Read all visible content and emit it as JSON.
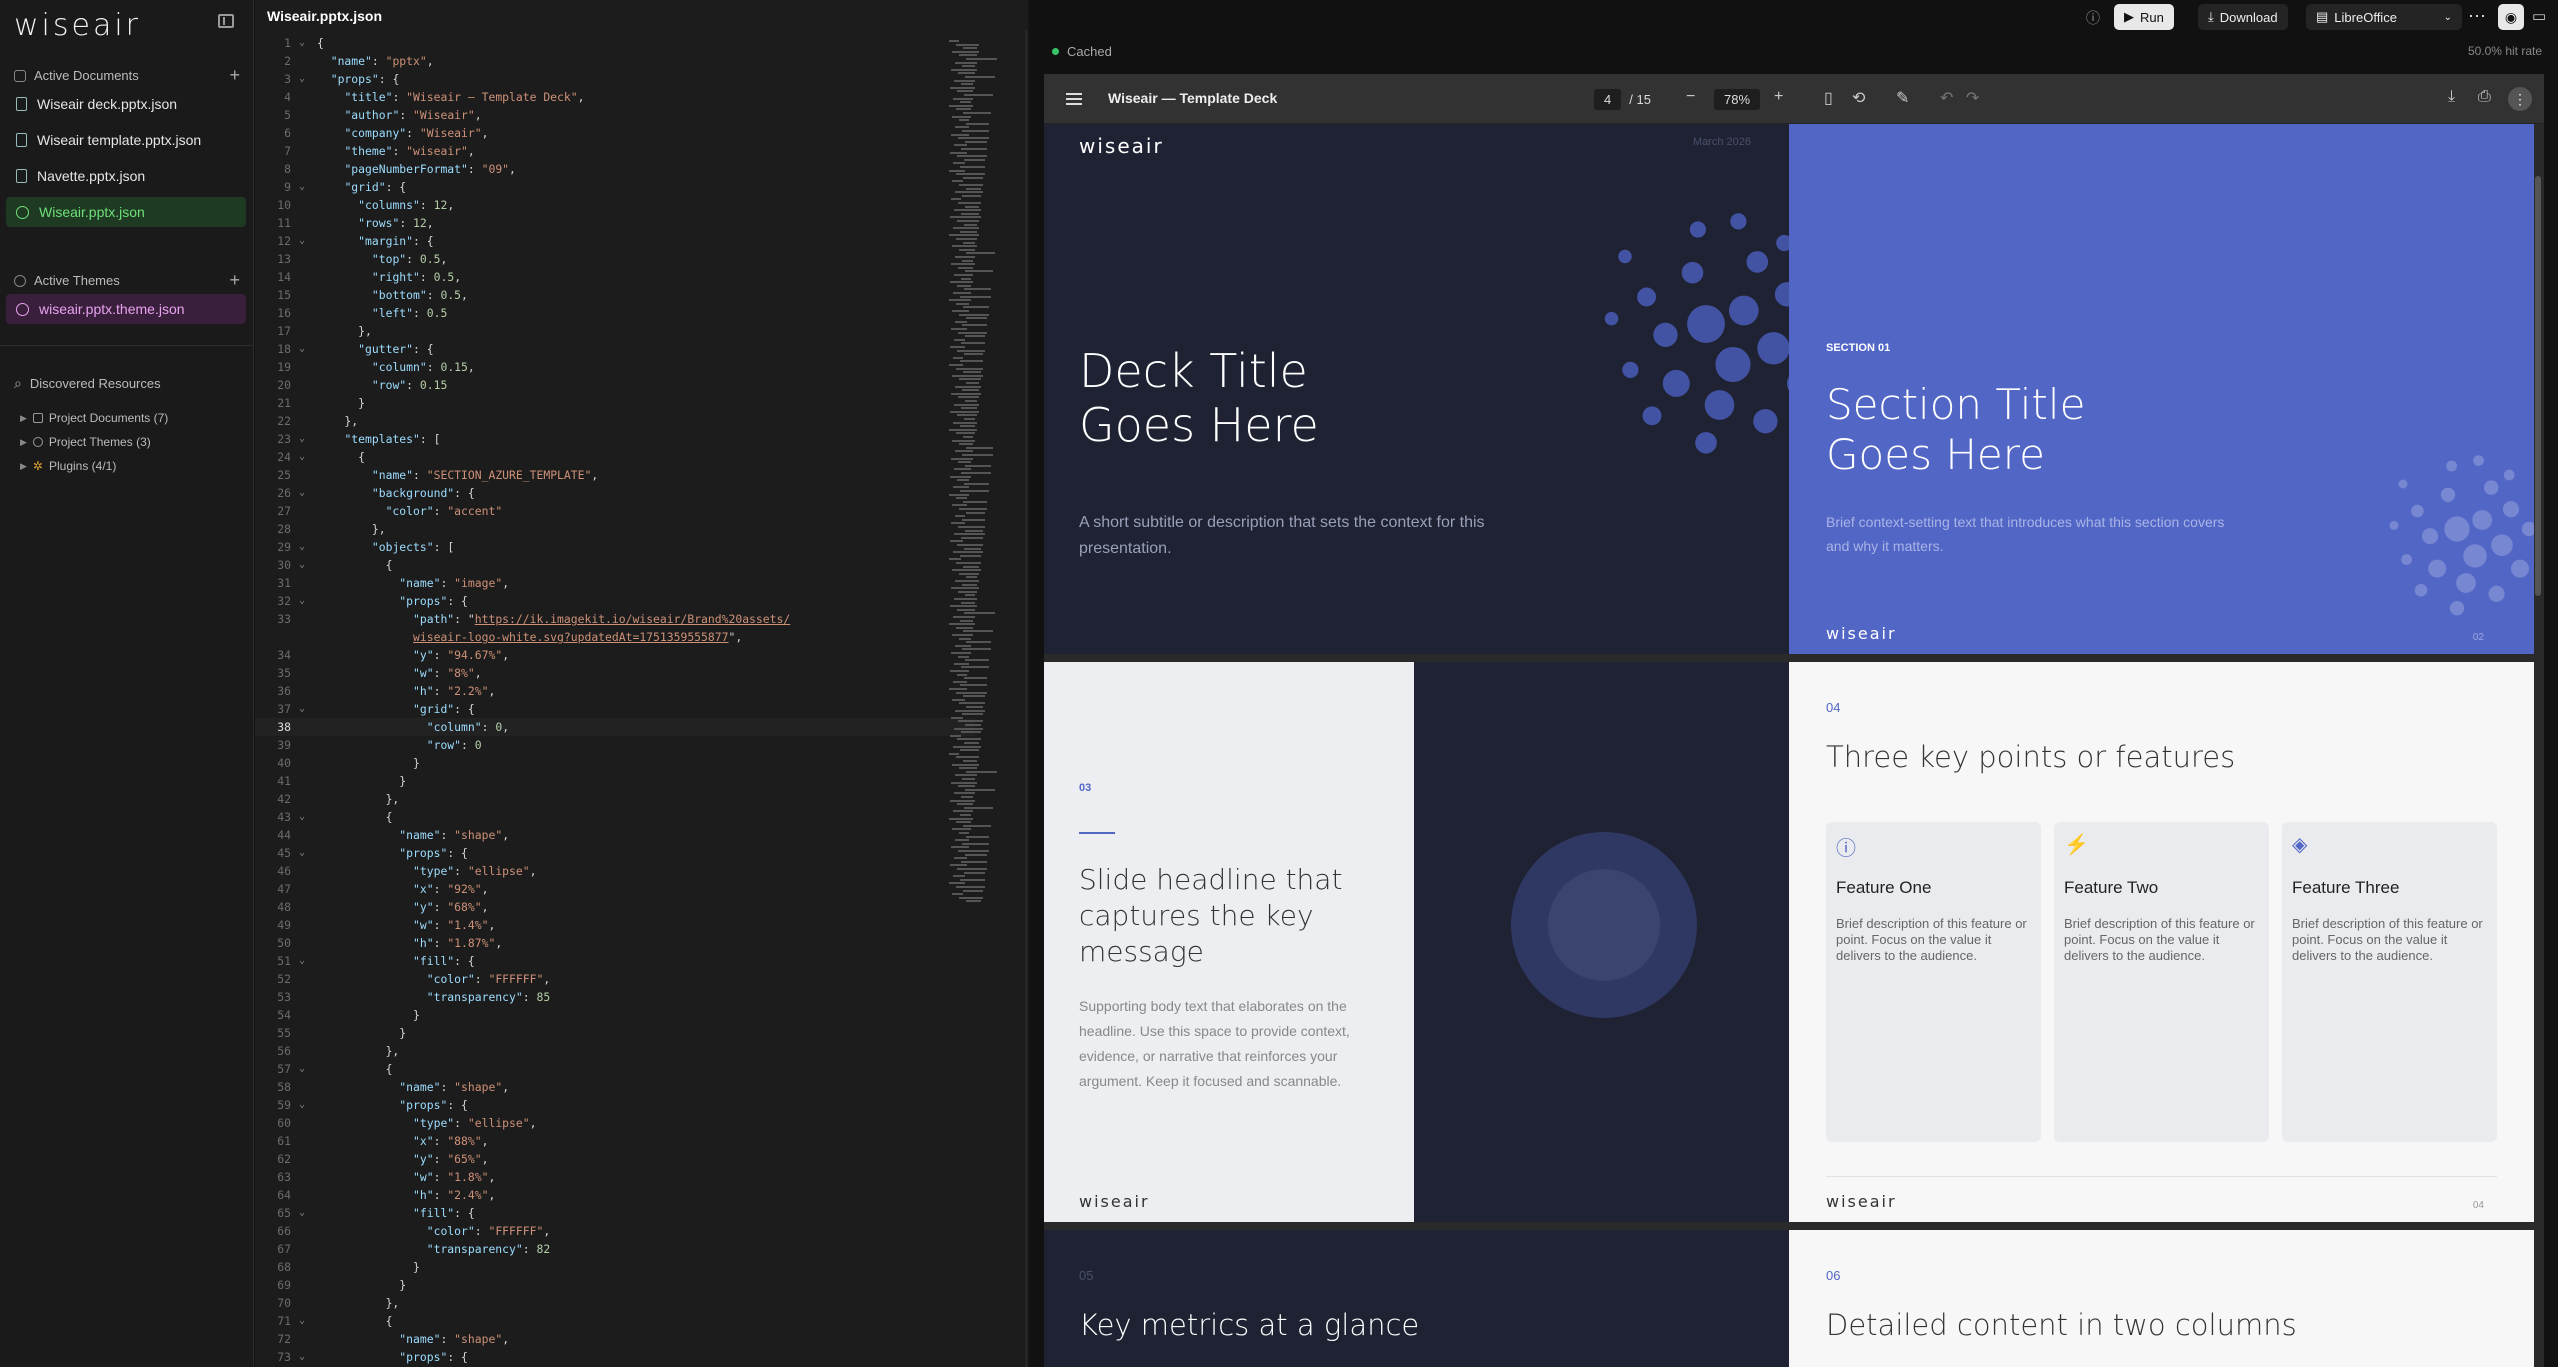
{
  "sidebar": {
    "brand": "wiseair",
    "active_documents_label": "Active Documents",
    "documents": [
      "Wiseair deck.pptx.json",
      "Wiseair template.pptx.json",
      "Navette.pptx.json",
      "Wiseair.pptx.json"
    ],
    "active_themes_label": "Active Themes",
    "themes": [
      "wiseair.pptx.theme.json"
    ],
    "discovered_label": "Discovered Resources",
    "resources": [
      "Project Documents (7)",
      "Project Themes (3)",
      "Plugins (4/1)"
    ]
  },
  "editor": {
    "file_name": "Wiseair.pptx.json",
    "current_line": 38,
    "lines": [
      {
        "n": "1",
        "f": "v",
        "t": "{"
      },
      {
        "n": "2",
        "f": "",
        "t": "  \"name\": \"pptx\","
      },
      {
        "n": "3",
        "f": "v",
        "t": "  \"props\": {"
      },
      {
        "n": "4",
        "f": "",
        "t": "    \"title\": \"Wiseair — Template Deck\","
      },
      {
        "n": "5",
        "f": "",
        "t": "    \"author\": \"Wiseair\","
      },
      {
        "n": "6",
        "f": "",
        "t": "    \"company\": \"Wiseair\","
      },
      {
        "n": "7",
        "f": "",
        "t": "    \"theme\": \"wiseair\","
      },
      {
        "n": "8",
        "f": "",
        "t": "    \"pageNumberFormat\": \"09\","
      },
      {
        "n": "9",
        "f": "v",
        "t": "    \"grid\": {"
      },
      {
        "n": "10",
        "f": "",
        "t": "      \"columns\": 12,"
      },
      {
        "n": "11",
        "f": "",
        "t": "      \"rows\": 12,"
      },
      {
        "n": "12",
        "f": "v",
        "t": "      \"margin\": {"
      },
      {
        "n": "13",
        "f": "",
        "t": "        \"top\": 0.5,"
      },
      {
        "n": "14",
        "f": "",
        "t": "        \"right\": 0.5,"
      },
      {
        "n": "15",
        "f": "",
        "t": "        \"bottom\": 0.5,"
      },
      {
        "n": "16",
        "f": "",
        "t": "        \"left\": 0.5"
      },
      {
        "n": "17",
        "f": "",
        "t": "      },"
      },
      {
        "n": "18",
        "f": "v",
        "t": "      \"gutter\": {"
      },
      {
        "n": "19",
        "f": "",
        "t": "        \"column\": 0.15,"
      },
      {
        "n": "20",
        "f": "",
        "t": "        \"row\": 0.15"
      },
      {
        "n": "21",
        "f": "",
        "t": "      }"
      },
      {
        "n": "22",
        "f": "",
        "t": "    },"
      },
      {
        "n": "23",
        "f": "v",
        "t": "    \"templates\": ["
      },
      {
        "n": "24",
        "f": "v",
        "t": "      {"
      },
      {
        "n": "25",
        "f": "",
        "t": "        \"name\": \"SECTION_AZURE_TEMPLATE\","
      },
      {
        "n": "26",
        "f": "v",
        "t": "        \"background\": {"
      },
      {
        "n": "27",
        "f": "",
        "t": "          \"color\": \"accent\""
      },
      {
        "n": "28",
        "f": "",
        "t": "        },"
      },
      {
        "n": "29",
        "f": "v",
        "t": "        \"objects\": ["
      },
      {
        "n": "30",
        "f": "v",
        "t": "          {"
      },
      {
        "n": "31",
        "f": "",
        "t": "            \"name\": \"image\","
      },
      {
        "n": "32",
        "f": "v",
        "t": "            \"props\": {"
      },
      {
        "n": "33",
        "f": "",
        "t": "              \"path\": \"https://ik.imagekit.io/wiseair/Brand%20assets/"
      },
      {
        "n": "",
        "f": "",
        "t": "              wiseair-logo-white.svg?updatedAt=1751359555877\","
      },
      {
        "n": "34",
        "f": "",
        "t": "              \"y\": \"94.67%\","
      },
      {
        "n": "35",
        "f": "",
        "t": "              \"w\": \"8%\","
      },
      {
        "n": "36",
        "f": "",
        "t": "              \"h\": \"2.2%\","
      },
      {
        "n": "37",
        "f": "v",
        "t": "              \"grid\": {"
      },
      {
        "n": "38",
        "f": "",
        "t": "                \"column\": 0,"
      },
      {
        "n": "39",
        "f": "",
        "t": "                \"row\": 0"
      },
      {
        "n": "40",
        "f": "",
        "t": "              }"
      },
      {
        "n": "41",
        "f": "",
        "t": "            }"
      },
      {
        "n": "42",
        "f": "",
        "t": "          },"
      },
      {
        "n": "43",
        "f": "v",
        "t": "          {"
      },
      {
        "n": "44",
        "f": "",
        "t": "            \"name\": \"shape\","
      },
      {
        "n": "45",
        "f": "v",
        "t": "            \"props\": {"
      },
      {
        "n": "46",
        "f": "",
        "t": "              \"type\": \"ellipse\","
      },
      {
        "n": "47",
        "f": "",
        "t": "              \"x\": \"92%\","
      },
      {
        "n": "48",
        "f": "",
        "t": "              \"y\": \"68%\","
      },
      {
        "n": "49",
        "f": "",
        "t": "              \"w\": \"1.4%\","
      },
      {
        "n": "50",
        "f": "",
        "t": "              \"h\": \"1.87%\","
      },
      {
        "n": "51",
        "f": "v",
        "t": "              \"fill\": {"
      },
      {
        "n": "52",
        "f": "",
        "t": "                \"color\": \"FFFFFF\","
      },
      {
        "n": "53",
        "f": "",
        "t": "                \"transparency\": 85"
      },
      {
        "n": "54",
        "f": "",
        "t": "              }"
      },
      {
        "n": "55",
        "f": "",
        "t": "            }"
      },
      {
        "n": "56",
        "f": "",
        "t": "          },"
      },
      {
        "n": "57",
        "f": "v",
        "t": "          {"
      },
      {
        "n": "58",
        "f": "",
        "t": "            \"name\": \"shape\","
      },
      {
        "n": "59",
        "f": "v",
        "t": "            \"props\": {"
      },
      {
        "n": "60",
        "f": "",
        "t": "              \"type\": \"ellipse\","
      },
      {
        "n": "61",
        "f": "",
        "t": "              \"x\": \"88%\","
      },
      {
        "n": "62",
        "f": "",
        "t": "              \"y\": \"65%\","
      },
      {
        "n": "63",
        "f": "",
        "t": "              \"w\": \"1.8%\","
      },
      {
        "n": "64",
        "f": "",
        "t": "              \"h\": \"2.4%\","
      },
      {
        "n": "65",
        "f": "v",
        "t": "              \"fill\": {"
      },
      {
        "n": "66",
        "f": "",
        "t": "                \"color\": \"FFFFFF\","
      },
      {
        "n": "67",
        "f": "",
        "t": "                \"transparency\": 82"
      },
      {
        "n": "68",
        "f": "",
        "t": "              }"
      },
      {
        "n": "69",
        "f": "",
        "t": "            }"
      },
      {
        "n": "70",
        "f": "",
        "t": "          },"
      },
      {
        "n": "71",
        "f": "v",
        "t": "          {"
      },
      {
        "n": "72",
        "f": "",
        "t": "            \"name\": \"shape\","
      },
      {
        "n": "73",
        "f": "v",
        "t": "            \"props\": {"
      }
    ]
  },
  "preview": {
    "run_label": "Run",
    "download_label": "Download",
    "renderer_label": "LibreOffice",
    "cached_label": "Cached",
    "hit_rate": "50.0% hit rate",
    "viewer_title": "Wiseair — Template Deck",
    "page_current": "4",
    "page_total": "/ 15",
    "zoom": "78%",
    "slides": {
      "s1": {
        "logo": "wiseair",
        "date": "March 2026",
        "title1": "Deck Title",
        "title2": "Goes Here",
        "subtitle": "A short subtitle or description that sets the context for this presentation."
      },
      "s2": {
        "eyebrow": "SECTION 01",
        "title1": "Section Title",
        "title2": "Goes Here",
        "body": "Brief context-setting text that introduces what this section covers and why it matters.",
        "logo": "wiseair",
        "page": "02"
      },
      "s3": {
        "num": "03",
        "headline": "Slide headline that captures the key message",
        "body": "Supporting body text that elaborates on the headline. Use this space to provide context, evidence, or narrative that reinforces your argument. Keep it focused and scannable.",
        "logo": "wiseair"
      },
      "s4": {
        "num": "04",
        "title": "Three key points or features",
        "features": [
          {
            "title": "Feature One",
            "desc": "Brief description of this feature or point. Focus on the value it delivers to the audience."
          },
          {
            "title": "Feature Two",
            "desc": "Brief description of this feature or point. Focus on the value it delivers to the audience."
          },
          {
            "title": "Feature Three",
            "desc": "Brief description of this feature or point. Focus on the value it delivers to the audience."
          }
        ],
        "logo": "wiseair",
        "page": "04"
      },
      "s5": {
        "num": "05",
        "title": "Key metrics at a glance"
      },
      "s6": {
        "num": "06",
        "title": "Detailed content in two columns"
      }
    }
  },
  "colors": {
    "accent": "#5266c6",
    "dark_slide": "#1f2233",
    "active_doc": "#6ee07a",
    "active_theme": "#e8a3ef"
  }
}
